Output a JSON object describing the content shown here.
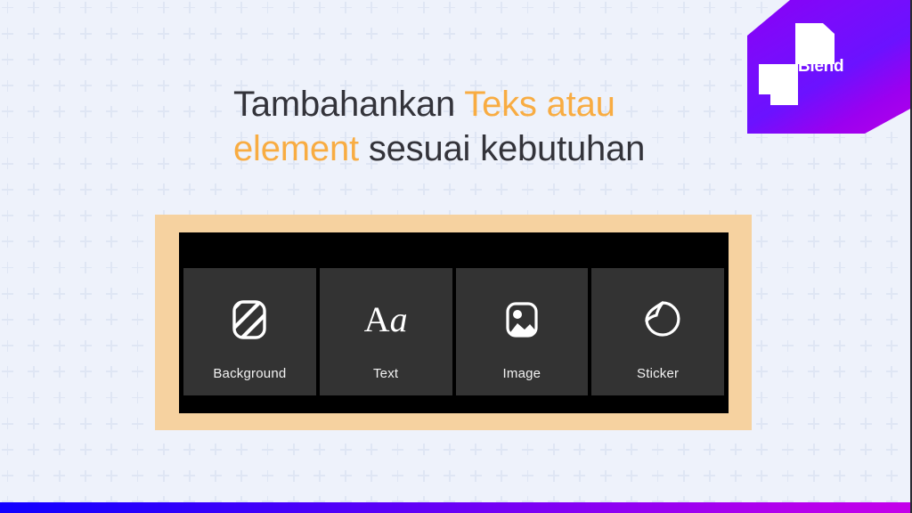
{
  "slide": {
    "background_color": "#eef2fb",
    "pattern_icon": "plus-pattern",
    "accent_orange": "#f8ac42",
    "heading_color": "#33333a",
    "frame_color": "#f6d2a0",
    "panel_color": "#000000",
    "tile_color": "#333333"
  },
  "heading": {
    "part1": "Tambahankan ",
    "highlight1": "Teks atau element",
    "part2": " sesuai kebutuhan"
  },
  "logo": {
    "wordmark": "Blend",
    "mark_icon": "blend-pinwheel-icon",
    "gradient_from": "#7b0bfb",
    "gradient_to": "#b400e8"
  },
  "toolbar": {
    "tiles": [
      {
        "label": "Background",
        "icon": "background-stripes-icon"
      },
      {
        "label": "Text",
        "icon": "text-aa-icon",
        "glyph_upper": "A",
        "glyph_lower": "a"
      },
      {
        "label": "Image",
        "icon": "image-photo-icon"
      },
      {
        "label": "Sticker",
        "icon": "sticker-peel-icon"
      }
    ]
  },
  "bottom_bar": {
    "gradient_from": "#1100ff",
    "gradient_to": "#c400ea"
  }
}
